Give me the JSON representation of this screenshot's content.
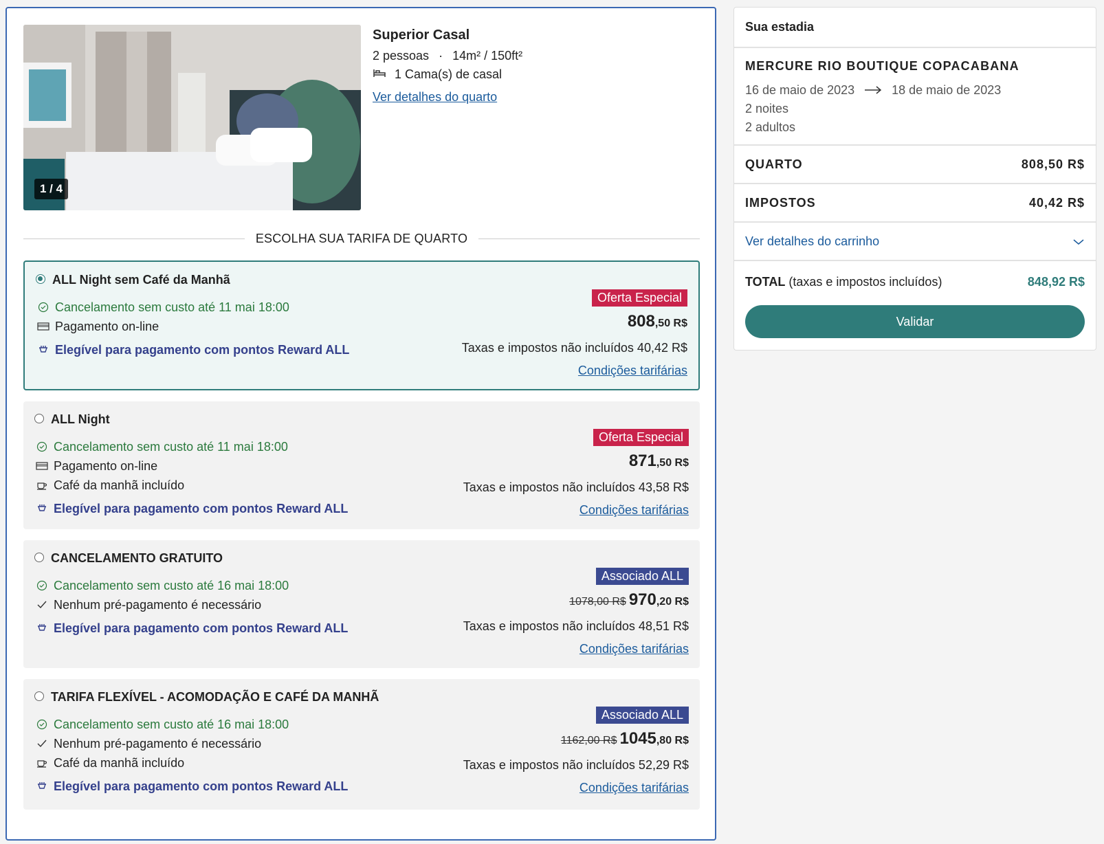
{
  "room": {
    "photo_counter": "1 / 4",
    "name": "Superior Casal",
    "occupancy": "2 pessoas",
    "size": "14m² / 150ft²",
    "bed": "1 Cama(s) de casal",
    "details_link": "Ver detalhes do quarto"
  },
  "rate_heading": "ESCOLHA SUA TARIFA DE QUARTO",
  "rates": [
    {
      "title": "ALL Night sem Café da Manhã",
      "cancel": "Cancelamento sem custo até 11 mai 18:00",
      "payment": "Pagamento on-line",
      "reward": "Elegível para pagamento com pontos Reward ALL",
      "badge": "Oferta Especial",
      "price_int": "808",
      "price_dec": ",50 R$",
      "taxes": "Taxas e impostos não incluídos 40,42 R$",
      "conditions": "Condições tarifárias"
    },
    {
      "title": "ALL Night",
      "cancel": "Cancelamento sem custo até 11 mai 18:00",
      "payment": "Pagamento on-line",
      "breakfast": "Café da manhã incluído",
      "reward": "Elegível para pagamento com pontos Reward ALL",
      "badge": "Oferta Especial",
      "price_int": "871",
      "price_dec": ",50 R$",
      "taxes": "Taxas e impostos não incluídos 43,58 R$",
      "conditions": "Condições tarifárias"
    },
    {
      "title": "CANCELAMENTO GRATUITO",
      "cancel": "Cancelamento sem custo até 16 mai 18:00",
      "payment": "Nenhum pré-pagamento é necessário",
      "reward": "Elegível para pagamento com pontos Reward ALL",
      "badge": "Associado ALL",
      "old_price": "1078,00 R$",
      "price_int": "970",
      "price_dec": ",20 R$",
      "taxes": "Taxas e impostos não incluídos 48,51 R$",
      "conditions": "Condições tarifárias"
    },
    {
      "title": "TARIFA FLEXÍVEL - ACOMODAÇÃO E CAFÉ DA MANHÃ",
      "cancel": "Cancelamento sem custo até 16 mai 18:00",
      "payment": "Nenhum pré-pagamento é necessário",
      "breakfast": "Café da manhã incluído",
      "reward": "Elegível para pagamento com pontos Reward ALL",
      "badge": "Associado ALL",
      "old_price": "1162,00 R$",
      "price_int": "1045",
      "price_dec": ",80 R$",
      "taxes": "Taxas e impostos não incluídos 52,29 R$",
      "conditions": "Condições tarifárias"
    }
  ],
  "summary": {
    "title": "Sua estadia",
    "hotel": "MERCURE RIO BOUTIQUE COPACABANA",
    "checkin": "16 de maio de 2023",
    "checkout": "18 de maio de 2023",
    "nights": "2 noites",
    "guests": "2 adultos",
    "room_label": "QUARTO",
    "room_amount": "808,50 R$",
    "tax_label": "IMPOSTOS",
    "tax_amount": "40,42 R$",
    "cart_link": "Ver detalhes do carrinho",
    "total_label": "TOTAL",
    "total_note": "(taxas e impostos incluídos)",
    "total_amount": "848,92 R$",
    "validate_label": "Validar"
  },
  "colors": {
    "accent_teal": "#2f7c7a",
    "link_blue": "#1b5b9c",
    "badge_red": "#c9234b",
    "badge_blue": "#3b4a91",
    "cancel_green": "#2b7a3d",
    "panel_border": "#3b68b3"
  }
}
